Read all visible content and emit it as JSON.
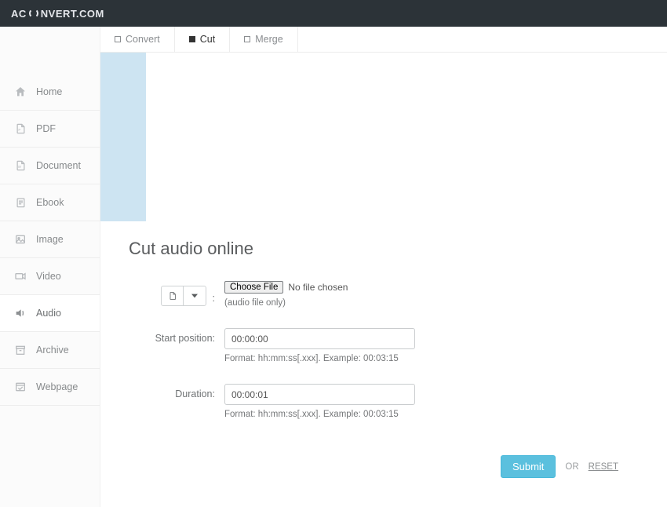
{
  "brand": {
    "pre": "AC",
    "post": "NVERT.COM"
  },
  "sidebar": {
    "items": [
      {
        "label": "Home",
        "icon": "home"
      },
      {
        "label": "PDF",
        "icon": "pdf"
      },
      {
        "label": "Document",
        "icon": "doc"
      },
      {
        "label": "Ebook",
        "icon": "ebook"
      },
      {
        "label": "Image",
        "icon": "image"
      },
      {
        "label": "Video",
        "icon": "video"
      },
      {
        "label": "Audio",
        "icon": "audio",
        "active": true
      },
      {
        "label": "Archive",
        "icon": "archive"
      },
      {
        "label": "Webpage",
        "icon": "webpage"
      }
    ]
  },
  "tabs": [
    {
      "label": "Convert",
      "active": false
    },
    {
      "label": "Cut",
      "active": true
    },
    {
      "label": "Merge",
      "active": false
    }
  ],
  "page": {
    "title": "Cut audio online"
  },
  "form": {
    "source_colon": ":",
    "choose_file_label": "Choose File",
    "no_file_label": "No file chosen",
    "audio_only_hint": "(audio file only)",
    "start_label": "Start position:",
    "start_value": "00:00:00",
    "start_hint": "Format: hh:mm:ss[.xxx]. Example: 00:03:15",
    "duration_label": "Duration:",
    "duration_value": "00:00:01",
    "duration_hint": "Format: hh:mm:ss[.xxx]. Example: 00:03:15"
  },
  "actions": {
    "submit": "Submit",
    "or": "OR",
    "reset": "RESET"
  }
}
